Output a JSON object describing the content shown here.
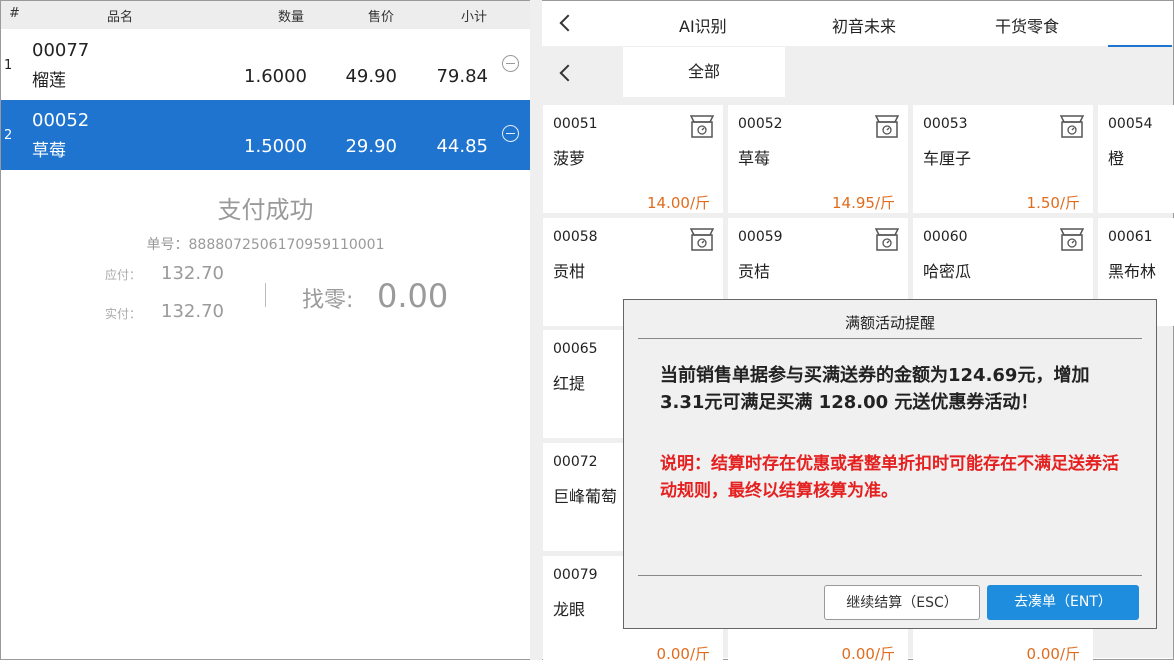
{
  "cart": {
    "headers": {
      "index": "#",
      "name": "品名",
      "qty": "数量",
      "price": "售价",
      "subtotal": "小计"
    },
    "rows": [
      {
        "index": "1",
        "code": "00077",
        "name": "榴莲",
        "qty": "1.6000",
        "price": "49.90",
        "subtotal": "79.84",
        "selected": false
      },
      {
        "index": "2",
        "code": "00052",
        "name": "草莓",
        "qty": "1.5000",
        "price": "29.90",
        "subtotal": "44.85",
        "selected": true
      }
    ]
  },
  "payment": {
    "status": "支付成功",
    "order_no": "单号：888807250617095911000​1",
    "due_label": "应付：",
    "due_value": "132.70",
    "paid_label": "实付：",
    "paid_value": "132.70",
    "change_label": "找零:",
    "change_value": "0.00"
  },
  "categories": {
    "tabs": [
      "AI识别",
      "初音未来",
      "干货零食"
    ],
    "sub_tabs": [
      "全部"
    ]
  },
  "products": [
    {
      "code": "00051",
      "name": "菠萝",
      "price": "14.00/斤"
    },
    {
      "code": "00052",
      "name": "草莓",
      "price": "14.95/斤"
    },
    {
      "code": "00053",
      "name": "车厘子",
      "price": "1.50/斤"
    },
    {
      "code": "00054",
      "name": "橙",
      "price": ""
    },
    {
      "code": "00058",
      "name": "贡柑",
      "price": ""
    },
    {
      "code": "00059",
      "name": "贡桔",
      "price": ""
    },
    {
      "code": "00060",
      "name": "哈密瓜",
      "price": ""
    },
    {
      "code": "00061",
      "name": "黑布林",
      "price": ""
    },
    {
      "code": "00065",
      "name": "红提",
      "price": ""
    },
    {
      "code": "00072",
      "name": "巨峰葡萄",
      "price": ""
    },
    {
      "code": "00079",
      "name": "龙眼",
      "price": "0.00/斤"
    },
    {
      "code": "",
      "name": "",
      "price": "0.00/斤"
    },
    {
      "code": "",
      "name": "",
      "price": "0.00/斤"
    }
  ],
  "modal": {
    "title": "满额活动提醒",
    "message": "当前销售单据参与买满送券的金额为124.69元，增加3.31元可满足买满 128.00 元送优惠券活动！",
    "note": "说明：结算时存在优惠或者整单折扣时可能存在不满足送券活动规则，最终以结算核算为准。",
    "continue_label": "继续结算（ESC）",
    "go_label": "去凑单（ENT）"
  },
  "colors": {
    "accent": "#1f74cf",
    "price": "#e06c1e",
    "warning": "#e52020"
  }
}
